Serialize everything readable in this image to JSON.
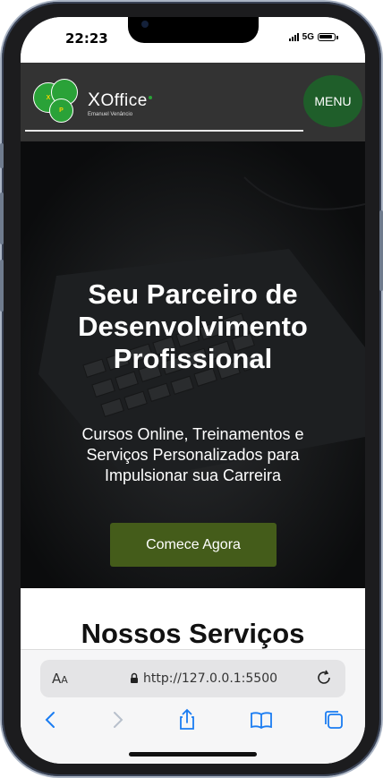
{
  "status_bar": {
    "time": "22:23",
    "network": "5G"
  },
  "header": {
    "logo_letters": [
      "X",
      "P"
    ],
    "brand_prefix": "X",
    "brand_rest": "Office",
    "brand_sub": "Emanuel Venâncio",
    "menu_label": "MENU"
  },
  "hero": {
    "title_lines": [
      "Seu Parceiro de",
      "Desenvolvimento",
      "Profissional"
    ],
    "subtitle_lines": [
      "Cursos Online, Treinamentos e",
      "Serviços Personalizados para",
      "Impulsionar sua Carreira"
    ],
    "cta_label": "Comece Agora"
  },
  "services": {
    "title": "Nossos Serviços"
  },
  "browser": {
    "text_size_label_big": "A",
    "text_size_label_small": "A",
    "url": "http://127.0.0.1:5500"
  },
  "colors": {
    "header_bg": "#333333",
    "logo_green": "#2aa238",
    "menu_bg": "#1f5e2a",
    "cta_bg": "#445c1a",
    "hero_bg": "#121416",
    "link_blue": "#1a7cf2"
  },
  "icons": [
    "lock-icon",
    "reload-icon",
    "back-icon",
    "forward-icon",
    "share-icon",
    "bookmarks-icon",
    "tabs-icon"
  ]
}
